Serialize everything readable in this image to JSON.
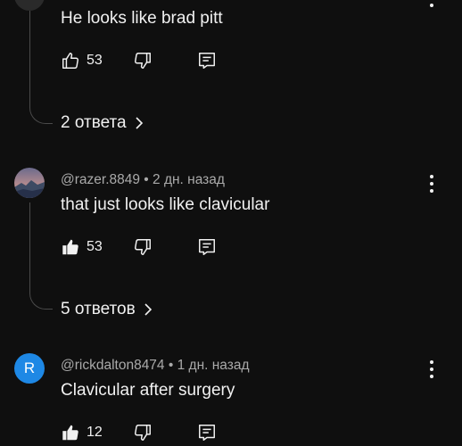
{
  "comments": [
    {
      "author_line": "",
      "text": "He looks like brad pitt",
      "likes": "53",
      "replies_label": "2 ответа"
    },
    {
      "author": "@razer.8849",
      "time": "2 дн. назад",
      "author_line": "@razer.8849 • 2 дн. назад",
      "text": "that just looks like clavicular",
      "likes": "53",
      "replies_label": "5 ответов"
    },
    {
      "author": "@rickdalton8474",
      "time": "1 дн. назад",
      "author_line": "@rickdalton8474 • 1 дн. назад",
      "avatar_letter": "R",
      "avatar_color": "#1e88e5",
      "text": "Clavicular after surgery",
      "likes": "12"
    }
  ],
  "icons": {
    "like": "thumbs-up-icon",
    "dislike": "thumbs-down-icon",
    "reply": "reply-comment-icon",
    "more": "more-vertical-icon",
    "expand": "chevron-right-icon"
  },
  "colors": {
    "background": "#0f0f0f",
    "text": "#f1f1f1",
    "secondary_text": "#aaaaaa",
    "thread_line": "#4a4a4a"
  }
}
